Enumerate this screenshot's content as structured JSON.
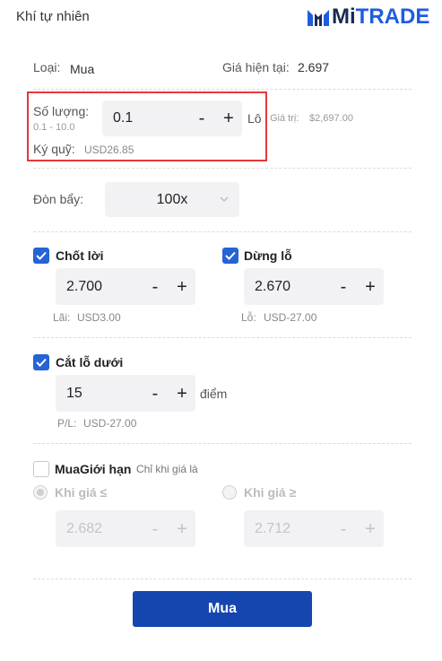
{
  "header": {
    "title": "Khí tự nhiên",
    "brand_mi": "Mi",
    "brand_trade": "TRADE"
  },
  "info": {
    "type_label": "Loại:",
    "type_value": "Mua",
    "price_label": "Giá hiện tại:",
    "price_value": "2.697"
  },
  "quantity": {
    "label": "Số lượng:",
    "range": "0.1 - 10.0",
    "value": "0.1",
    "unit": "Lô",
    "value_label": "Giá trị:",
    "value_amount": "$2,697.00",
    "margin_label": "Ký quỹ:",
    "margin_value": "USD26.85",
    "minus": "-",
    "plus": "+"
  },
  "leverage": {
    "label": "Đòn bẩy:",
    "value": "100x"
  },
  "take_profit": {
    "label": "Chốt lời",
    "checked": true,
    "value": "2.700",
    "sub_label": "Lãi:",
    "sub_value": "USD3.00",
    "minus": "-",
    "plus": "+"
  },
  "stop_loss": {
    "label": "Dừng lỗ",
    "checked": true,
    "value": "2.670",
    "sub_label": "Lỗ:",
    "sub_value": "USD-27.00",
    "minus": "-",
    "plus": "+"
  },
  "trailing_stop": {
    "label": "Cắt lỗ dưới",
    "checked": true,
    "value": "15",
    "unit": "điểm",
    "sub_label": "P/L:",
    "sub_value": "USD-27.00",
    "minus": "-",
    "plus": "+"
  },
  "limit_order": {
    "label": "MuaGiới hạn",
    "hint": "Chỉ khi giá là",
    "checked": false,
    "below_label": "Khi giá ≤",
    "below_value": "2.682",
    "above_label": "Khi giá ≥",
    "above_value": "2.712",
    "minus": "-",
    "plus": "+"
  },
  "submit": {
    "label": "Mua"
  },
  "colors": {
    "accent": "#2563d6",
    "primary_button": "#1546b0",
    "highlight": "#e5383b"
  }
}
